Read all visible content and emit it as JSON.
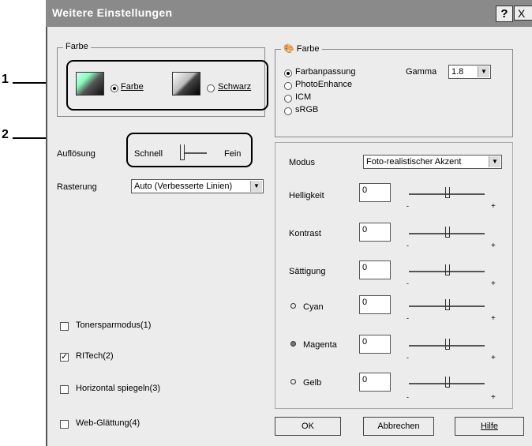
{
  "title": "Weitere Einstellungen",
  "help_btn": "?",
  "close_btn": "X",
  "callouts": {
    "one": "1",
    "two": "2"
  },
  "farbe_group": {
    "legend": "Farbe",
    "radio_farbe": "Farbe",
    "radio_schwarz": "Schwarz",
    "selected": "Farbe"
  },
  "aufloesung": {
    "label": "Auflösung",
    "left": "Schnell",
    "right": "Fein"
  },
  "rasterung": {
    "label": "Rasterung",
    "value": "Auto (Verbesserte Linien)"
  },
  "checkboxes": [
    {
      "label": "Tonersparmodus(1)",
      "checked": false
    },
    {
      "label": "RITech(2)",
      "checked": true
    },
    {
      "label": "Horizontal spiegeln(3)",
      "checked": false
    },
    {
      "label": "Web-Glättung(4)",
      "checked": false
    }
  ],
  "right_farbe": {
    "legend": "Farbe",
    "options": [
      "Farbanpassung",
      "PhotoEnhance",
      "ICM",
      "sRGB"
    ],
    "selected": "Farbanpassung",
    "gamma_label": "Gamma",
    "gamma_value": "1.8"
  },
  "modus": {
    "label": "Modus",
    "value": "Foto-realistischer Akzent"
  },
  "adjust": [
    {
      "label": "Helligkeit",
      "value": "0"
    },
    {
      "label": "Kontrast",
      "value": "0"
    },
    {
      "label": "Sättigung",
      "value": "0"
    },
    {
      "label": "Cyan",
      "value": "0"
    },
    {
      "label": "Magenta",
      "value": "0"
    },
    {
      "label": "Gelb",
      "value": "0"
    }
  ],
  "minus": "-",
  "plus": "+",
  "buttons": {
    "ok": "OK",
    "cancel": "Abbrechen",
    "help": "Hilfe"
  }
}
